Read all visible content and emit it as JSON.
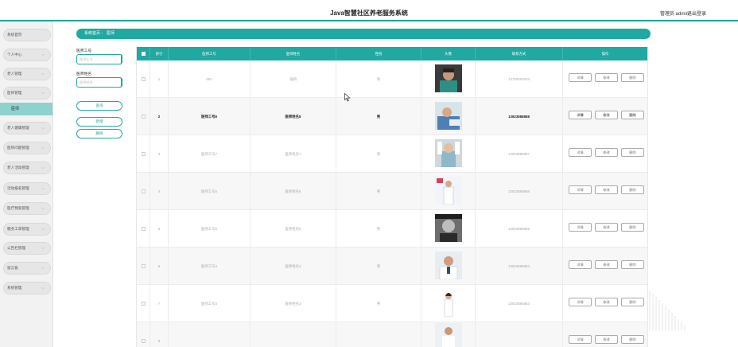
{
  "header": {
    "title": "Java智慧社区养老服务系统",
    "user": "管理员 admin",
    "logout": "退出登录"
  },
  "sidebar": {
    "items": [
      {
        "label": "系统首页",
        "has_chevron": false
      },
      {
        "label": "个人中心",
        "has_chevron": true
      },
      {
        "label": "老人管理",
        "has_chevron": true
      },
      {
        "label": "医师管理",
        "has_chevron": true
      },
      {
        "label": "老人健康管理",
        "has_chevron": true
      },
      {
        "label": "医师问题管理",
        "has_chevron": true
      },
      {
        "label": "老人活动管理",
        "has_chevron": true
      },
      {
        "label": "活动报名管理",
        "has_chevron": true
      },
      {
        "label": "医疗预案管理",
        "has_chevron": true
      },
      {
        "label": "服务工单管理",
        "has_chevron": true
      },
      {
        "label": "公告栏管理",
        "has_chevron": true
      },
      {
        "label": "留言板",
        "has_chevron": true
      },
      {
        "label": "系统管理",
        "has_chevron": true
      }
    ],
    "active_sub": "医师"
  },
  "breadcrumb": {
    "home": "系统首页",
    "sep": "：",
    "current": "医师"
  },
  "search": {
    "field1_label": "医师工号",
    "field1_placeholder": "医师工号",
    "field2_label": "医师姓名",
    "field2_placeholder": "医师姓名",
    "query_button": "查询",
    "add_button": "新增",
    "delete_button": "删除"
  },
  "table": {
    "columns": [
      "",
      "索引",
      "医师工号",
      "医师姓名",
      "性别",
      "头像",
      "联系方式",
      "操作"
    ],
    "actions": [
      "详情",
      "修改",
      "删除"
    ],
    "rows": [
      {
        "index": "1",
        "id": "002",
        "name": "张四",
        "gender": "男",
        "phone": "13700000004",
        "style": "faded",
        "photo": "man-teal-shirt"
      },
      {
        "index": "2",
        "id": "医师工号8",
        "name": "医师姓名8",
        "gender": "男",
        "phone": "13823888888",
        "style": "bold",
        "photo": "doctor-scrubs"
      },
      {
        "index": "3",
        "id": "医师工号7",
        "name": "医师姓名7",
        "gender": "男",
        "phone": "13823888887",
        "style": "faded",
        "photo": "doctor-gloves"
      },
      {
        "index": "4",
        "id": "医师工号6",
        "name": "医师姓名6",
        "gender": "男",
        "phone": "13823888886",
        "style": "faded",
        "photo": "doctor-white-coat"
      },
      {
        "index": "5",
        "id": "医师工号5",
        "name": "医师姓名5",
        "gender": "男",
        "phone": "13823888885",
        "style": "faded",
        "photo": "bw-portrait"
      },
      {
        "index": "6",
        "id": "医师工号4",
        "name": "医师姓名4",
        "gender": "男",
        "phone": "13823888884",
        "style": "faded",
        "photo": "doctor-smiling"
      },
      {
        "index": "7",
        "id": "医师工号3",
        "name": "医师姓名3",
        "gender": "男",
        "phone": "13823888883",
        "style": "faded",
        "photo": "doctor-female"
      },
      {
        "index": "8",
        "id": "",
        "name": "",
        "gender": "",
        "phone": "",
        "style": "faded",
        "photo": "doctor-partial"
      }
    ]
  },
  "colors": {
    "accent": "#1fa9a0",
    "sidebar_active": "#8fd1cc"
  }
}
